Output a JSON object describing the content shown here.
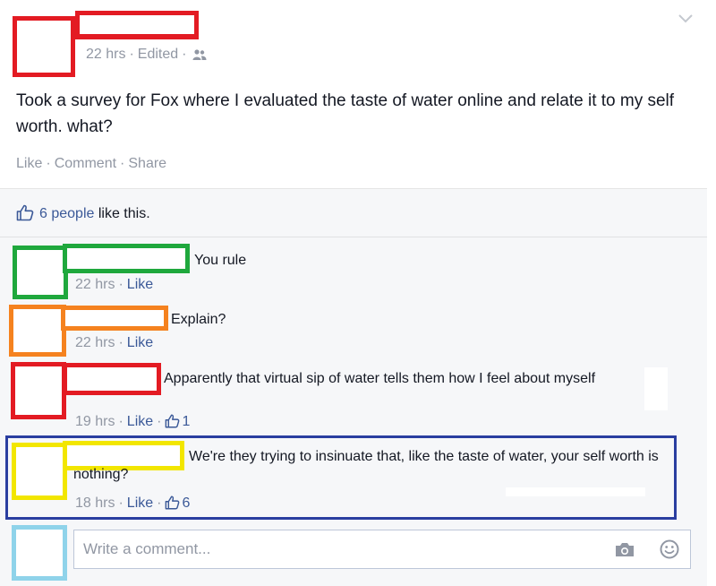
{
  "post": {
    "timestamp": "22 hrs",
    "edited": "Edited",
    "text": "Took a survey for Fox where I evaluated the taste of water online and relate it to my self worth. what?",
    "actions": {
      "like": "Like",
      "comment": "Comment",
      "share": "Share"
    }
  },
  "likes": {
    "count": "6 people",
    "suffix": "like this."
  },
  "comments": [
    {
      "text": "You rule",
      "time": "22 hrs",
      "like": "Like",
      "likes": ""
    },
    {
      "text": "Explain?",
      "time": "22 hrs",
      "like": "Like",
      "likes": ""
    },
    {
      "text": "Apparently that virtual sip of water tells them how I feel about myself",
      "time": "19 hrs",
      "like": "Like",
      "likes": "1"
    },
    {
      "text": "We're they trying to insinuate that, like the taste of water, your self worth is nothing?",
      "time": "18 hrs",
      "like": "Like",
      "likes": "6"
    }
  ],
  "composer": {
    "placeholder": "Write a comment..."
  },
  "colors": {
    "link": "#3b5998",
    "muted": "#9197a3",
    "redact_red": "#e31b23",
    "redact_green": "#1fa83d",
    "redact_orange": "#f5821f",
    "redact_yellow": "#f2e600",
    "highlight_blue": "#2a3ea0",
    "redact_lightblue": "#8fd3ea"
  }
}
